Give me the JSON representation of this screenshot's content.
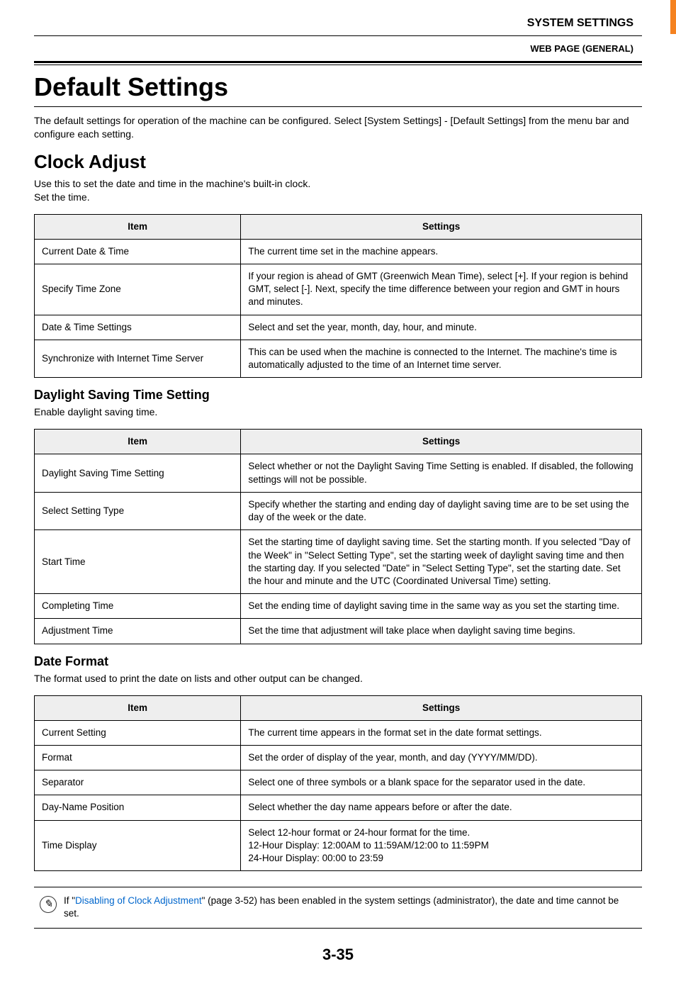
{
  "header": {
    "section": "SYSTEM SETTINGS",
    "tag": "WEB PAGE (GENERAL)"
  },
  "title": "Default Settings",
  "title_desc": "The default settings for operation of the machine can be configured. Select [System Settings] - [Default Settings] from the menu bar and configure each setting.",
  "clock": {
    "heading": "Clock Adjust",
    "desc_line1": "Use this to set the date and time in the machine's built-in clock.",
    "desc_line2": "Set the time.",
    "table": {
      "col_item": "Item",
      "col_settings": "Settings",
      "rows": [
        {
          "item": "Current Date & Time",
          "settings": "The current time set in the machine appears."
        },
        {
          "item": "Specify Time Zone",
          "settings": "If your region is ahead of GMT (Greenwich Mean Time), select [+]. If your region is behind GMT, select [-]. Next, specify the time difference between your region and GMT in hours and minutes."
        },
        {
          "item": "Date & Time Settings",
          "settings": "Select and set the year, month, day, hour, and minute."
        },
        {
          "item": "Synchronize with Internet Time Server",
          "settings": "This can be used when the machine is connected to the Internet. The machine's time is automatically adjusted to the time of an Internet time server."
        }
      ]
    }
  },
  "dst": {
    "heading": "Daylight Saving Time Setting",
    "desc": "Enable daylight saving time.",
    "table": {
      "col_item": "Item",
      "col_settings": "Settings",
      "rows": [
        {
          "item": "Daylight Saving Time Setting",
          "settings": "Select whether or not the Daylight Saving Time Setting is enabled. If disabled, the following settings will not be possible."
        },
        {
          "item": "Select Setting Type",
          "settings": "Specify whether the starting and ending day of daylight saving time are to be set using the day of the week or the date."
        },
        {
          "item": "Start Time",
          "settings": "Set the starting time of daylight saving time. Set the starting month. If you selected \"Day of the Week\" in \"Select Setting Type\", set the starting week of daylight saving time and then the starting day. If you selected \"Date\" in \"Select Setting Type\", set the starting date. Set the hour and minute and the UTC (Coordinated Universal Time) setting."
        },
        {
          "item": "Completing Time",
          "settings": "Set the ending time of daylight saving time in the same way as you set the starting time."
        },
        {
          "item": "Adjustment Time",
          "settings": "Set the time that adjustment will take place when daylight saving time begins."
        }
      ]
    }
  },
  "dateformat": {
    "heading": "Date Format",
    "desc": "The format used to print the date on lists and other output can be changed.",
    "table": {
      "col_item": "Item",
      "col_settings": "Settings",
      "rows": [
        {
          "item": "Current Setting",
          "settings": "The current time appears in the format set in the date format settings."
        },
        {
          "item": "Format",
          "settings": "Set the order of display of the year, month, and day (YYYY/MM/DD)."
        },
        {
          "item": "Separator",
          "settings": "Select one of three symbols or a blank space for the separator used in the date."
        },
        {
          "item": "Day-Name Position",
          "settings": "Select whether the day name appears before or after the date."
        },
        {
          "item": "Time Display",
          "settings": "Select 12-hour format or 24-hour format for the time.\n12-Hour Display: 12:00AM to 11:59AM/12:00 to 11:59PM\n24-Hour Display: 00:00 to 23:59"
        }
      ]
    }
  },
  "note": {
    "prefix": "If \"",
    "link": "Disabling of Clock Adjustment",
    "suffix": "\" (page 3-52) has been enabled in the system settings (administrator), the date and time cannot be set."
  },
  "page_number": "3-35"
}
